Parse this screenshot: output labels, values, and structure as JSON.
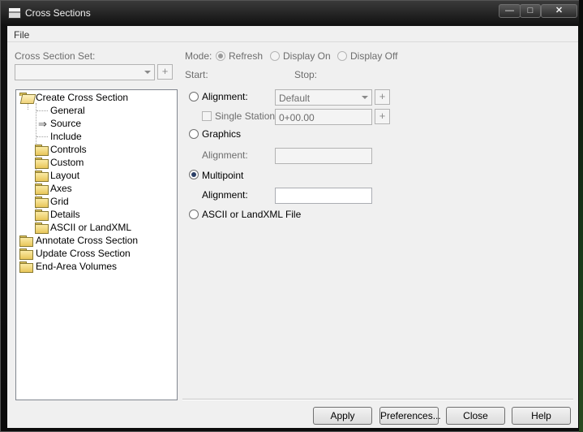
{
  "window": {
    "title": "Cross Sections",
    "minimize_glyph": "―",
    "maximize_glyph": "□",
    "close_glyph": "✕"
  },
  "menu": {
    "file": "File"
  },
  "cross_section_set": {
    "label": "Cross Section Set:",
    "value": ""
  },
  "mode": {
    "label": "Mode:",
    "options": [
      "Refresh",
      "Display On",
      "Display Off"
    ],
    "selected": "Refresh"
  },
  "start_label": "Start:",
  "stop_label": "Stop:",
  "tree": {
    "root_create": "Create Cross Section",
    "create_children": [
      "General",
      "Source",
      "Include",
      "Controls",
      "Custom",
      "Layout",
      "Axes",
      "Grid",
      "Details",
      "ASCII or LandXML"
    ],
    "selected_child": "Source",
    "root_annotate": "Annotate Cross Section",
    "root_update": "Update Cross Section",
    "root_end_area": "End-Area Volumes"
  },
  "source": {
    "alignment_radio": "Alignment:",
    "alignment_value": "Default",
    "single_station_label": "Single Station:",
    "single_station_value": "0+00.00",
    "graphics_radio": "Graphics",
    "graphics_alignment_label": "Alignment:",
    "graphics_alignment_value": "",
    "multipoint_radio": "Multipoint",
    "multipoint_alignment_label": "Alignment:",
    "multipoint_alignment_value": "",
    "ascii_radio": "ASCII or LandXML File",
    "selected": "Multipoint"
  },
  "buttons": {
    "apply": "Apply",
    "preferences": "Preferences...",
    "close": "Close",
    "help": "Help"
  },
  "icons": {
    "app": "cross-section-app-icon",
    "pick": "crosshair-pick-icon",
    "folder": "folder-icon",
    "arrow": "arrow-right-icon"
  }
}
